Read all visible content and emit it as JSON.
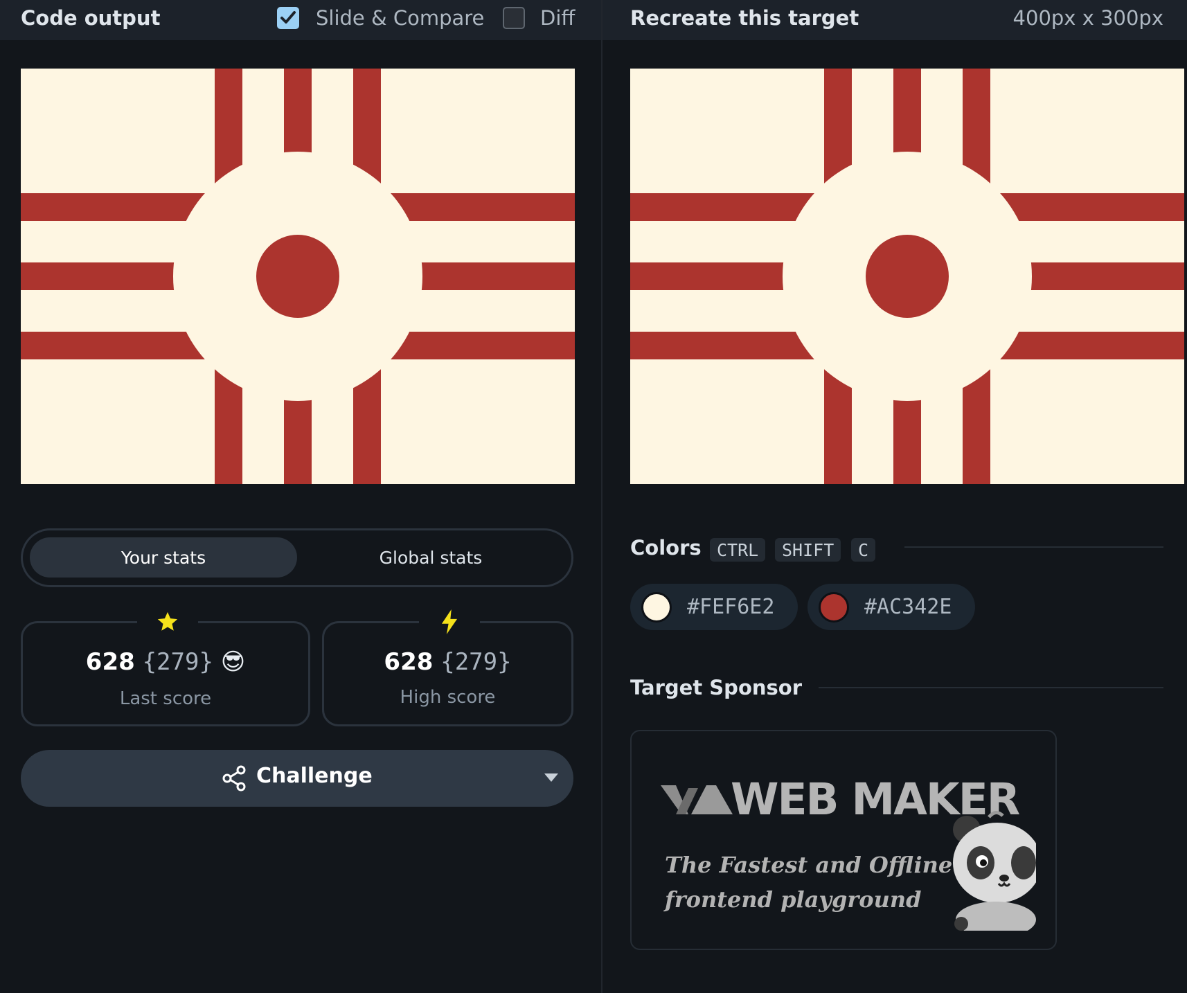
{
  "left_panel": {
    "title": "Code output",
    "slide_compare": {
      "label": "Slide & Compare",
      "checked": true
    },
    "diff": {
      "label": "Diff",
      "checked": false
    },
    "stats_tabs": {
      "active": "Your stats",
      "inactive": "Global stats"
    },
    "last_score": {
      "badge": "star-icon",
      "value": "628",
      "sub": "{279}",
      "emoji": "😎",
      "label": "Last score"
    },
    "high_score": {
      "badge": "lightning-icon",
      "value": "628",
      "sub": "{279}",
      "label": "High score"
    },
    "challenge": {
      "label": "Challenge"
    }
  },
  "right_panel": {
    "title": "Recreate this target",
    "dimensions": "400px x 300px",
    "colors": {
      "heading": "Colors",
      "shortcut": [
        "CTRL",
        "SHIFT",
        "C"
      ],
      "swatches": [
        {
          "hex": "#FEF6E2",
          "color": "#fef6e2"
        },
        {
          "hex": "#AC342E",
          "color": "#ac342e"
        }
      ]
    },
    "sponsor": {
      "heading": "Target Sponsor",
      "logo_text": "WEB MAKER",
      "tagline_line1": "The Fastest and Offline",
      "tagline_line2": "frontend playground"
    }
  },
  "palette": {
    "background": "#fef6e2",
    "accent": "#ac342e"
  }
}
